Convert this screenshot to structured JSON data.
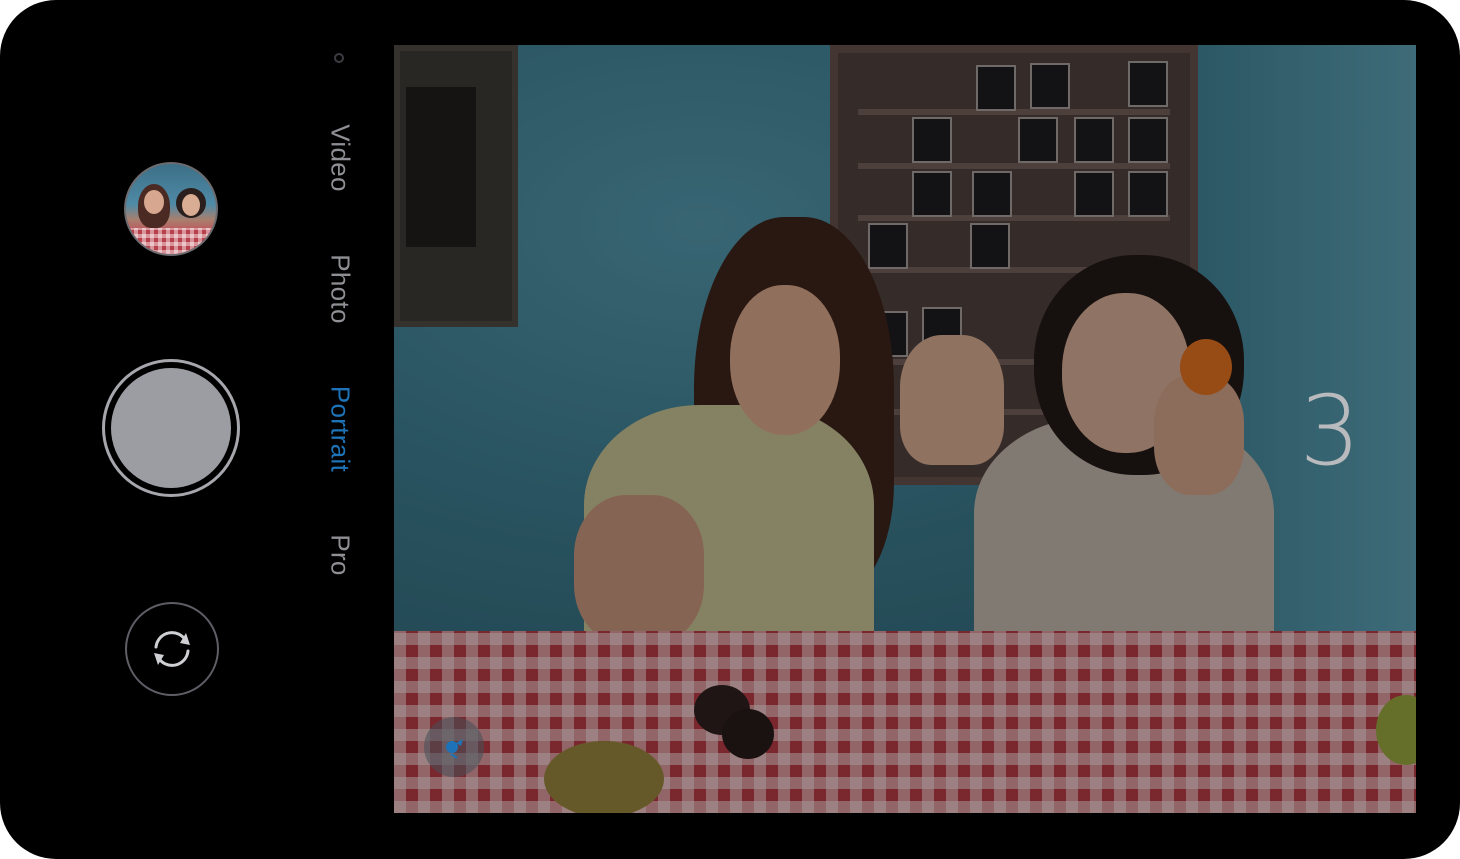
{
  "modes": [
    {
      "label": "Video",
      "active": false
    },
    {
      "label": "Photo",
      "active": false
    },
    {
      "label": "Portrait",
      "active": true
    },
    {
      "label": "Pro",
      "active": false
    }
  ],
  "viewfinder": {
    "countdown": "3"
  },
  "icons": {
    "switch_camera": "switch-camera-icon",
    "bokeh": "bokeh-icon",
    "more_modes": "more-modes-dot-icon"
  },
  "colors": {
    "active_mode": "#1e73b8",
    "inactive_mode": "#8f9095",
    "shutter": "#9c9ca3",
    "background": "#000000"
  }
}
